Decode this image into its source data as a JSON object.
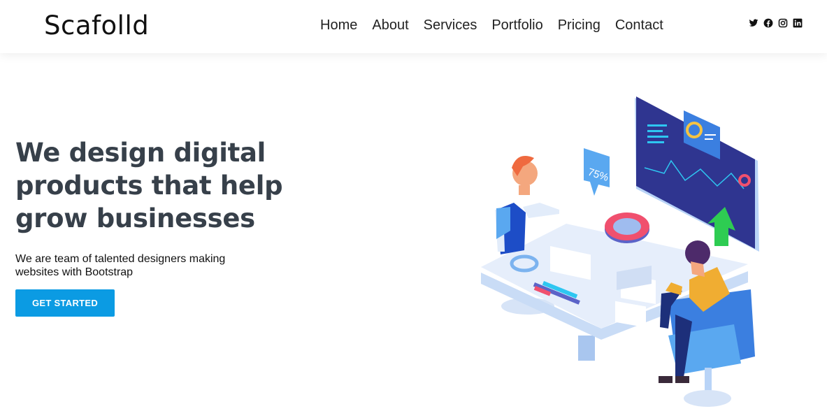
{
  "brand": {
    "logo": "Scafolld"
  },
  "nav": {
    "items": [
      {
        "label": "Home"
      },
      {
        "label": "About"
      },
      {
        "label": "Services"
      },
      {
        "label": "Portfolio"
      },
      {
        "label": "Pricing"
      },
      {
        "label": "Contact"
      }
    ]
  },
  "social": {
    "icons": [
      "twitter-icon",
      "facebook-icon",
      "instagram-icon",
      "linkedin-icon"
    ]
  },
  "hero": {
    "title": "We design digital products that help grow businesses",
    "subtitle": "We are team of talented designers making websites with Bootstrap",
    "cta_label": "GET STARTED"
  },
  "illustration": {
    "badge_text": "75%"
  },
  "colors": {
    "accent": "#0b9be3",
    "heading": "#37404a",
    "screen": "#2f3590"
  }
}
